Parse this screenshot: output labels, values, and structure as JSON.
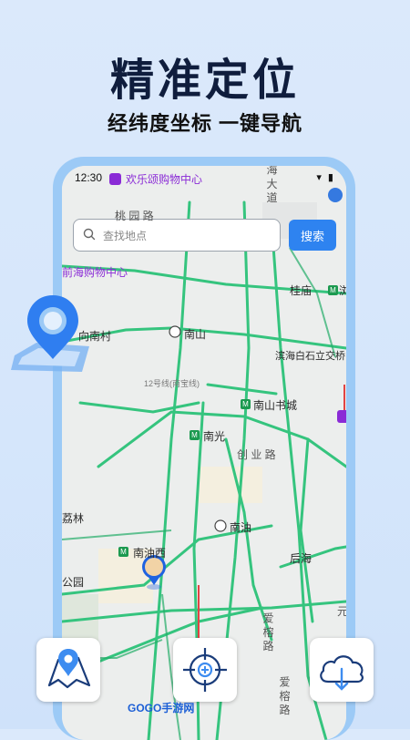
{
  "promo": {
    "headline": "精准定位",
    "subline": "经纬度坐标 一键导航"
  },
  "status_bar": {
    "time": "12:30",
    "icons": "▾ ▮"
  },
  "search": {
    "placeholder": "查找地点",
    "button_label": "搜索"
  },
  "map": {
    "labels": {
      "huanle": "欢乐颂购物中心",
      "qianhai": "前海购物中心",
      "xiangnancun": "向南村",
      "nanshan": "南山",
      "guimiao": "桂庙",
      "yue": "浏",
      "binhai": "滨海白石立交桥",
      "line12": "12号线(南宝线)",
      "nanshanshucheng": "南山书城",
      "nanguang": "南光",
      "chuangyelu": "创 业 路",
      "nanyou": "南油",
      "lilin": "荔林",
      "nanyouxi": "南油西",
      "houhai": "后海",
      "gongyuan": "公园",
      "taoyuanlu": "桃 园 路",
      "haidadao": "海 大 道",
      "aiyulu": "爱 榕 路",
      "aiyulu2": "爱 榕 路",
      "yuan": "元"
    }
  },
  "watermark": "GOGO手游网",
  "colors": {
    "accent": "#2e83f0",
    "road_green": "#2cc37a",
    "headline": "#0f1d3d"
  }
}
